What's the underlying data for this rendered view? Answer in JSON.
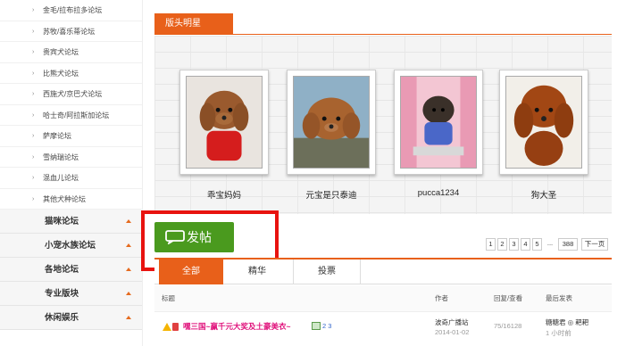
{
  "sidebar": {
    "forums": [
      {
        "label": "金毛/拉布拉多论坛"
      },
      {
        "label": "苏牧/喜乐蒂论坛"
      },
      {
        "label": "贵宾犬论坛"
      },
      {
        "label": "比熊犬论坛"
      },
      {
        "label": "西施犬/京巴犬论坛"
      },
      {
        "label": "哈士奇/阿拉斯加论坛"
      },
      {
        "label": "萨摩论坛"
      },
      {
        "label": "雪纳瑞论坛"
      },
      {
        "label": "混血儿论坛"
      },
      {
        "label": "其他犬种论坛"
      }
    ],
    "arrow": "›",
    "groups": [
      {
        "label": "猫咪论坛"
      },
      {
        "label": "小宠水族论坛"
      },
      {
        "label": "各地论坛"
      },
      {
        "label": "专业版块"
      },
      {
        "label": "休闲娱乐"
      }
    ]
  },
  "stars": {
    "title": "版头明星",
    "items": [
      {
        "name": "乖宝妈妈"
      },
      {
        "name": "元宝是只泰迪"
      },
      {
        "name": "pucca1234"
      },
      {
        "name": "狗大圣"
      }
    ]
  },
  "post_button": {
    "label": "发帖"
  },
  "pager": {
    "pages": [
      "1",
      "2",
      "3",
      "4",
      "5"
    ],
    "ellipsis": "...",
    "last": "388",
    "next": "下一页"
  },
  "tabs": [
    {
      "label": "全部",
      "active": true
    },
    {
      "label": "精华",
      "active": false
    },
    {
      "label": "投票",
      "active": false
    }
  ],
  "table": {
    "headers": {
      "title": "标题",
      "author": "作者",
      "stats": "回复/查看",
      "last": "最后发表"
    },
    "rows": [
      {
        "title": "嘿三国~赢千元大奖及土豪美衣~",
        "pages": "2 3",
        "author": "波奇广播站",
        "date": "2014-01-02",
        "stats": "75/16128",
        "last_user": "糖糖君 ◎ 耙耙",
        "last_time": "1 小时前"
      }
    ]
  },
  "colors": {
    "accent": "#e8601a",
    "button": "#4a9a1e",
    "highlight": "#e8130f"
  }
}
